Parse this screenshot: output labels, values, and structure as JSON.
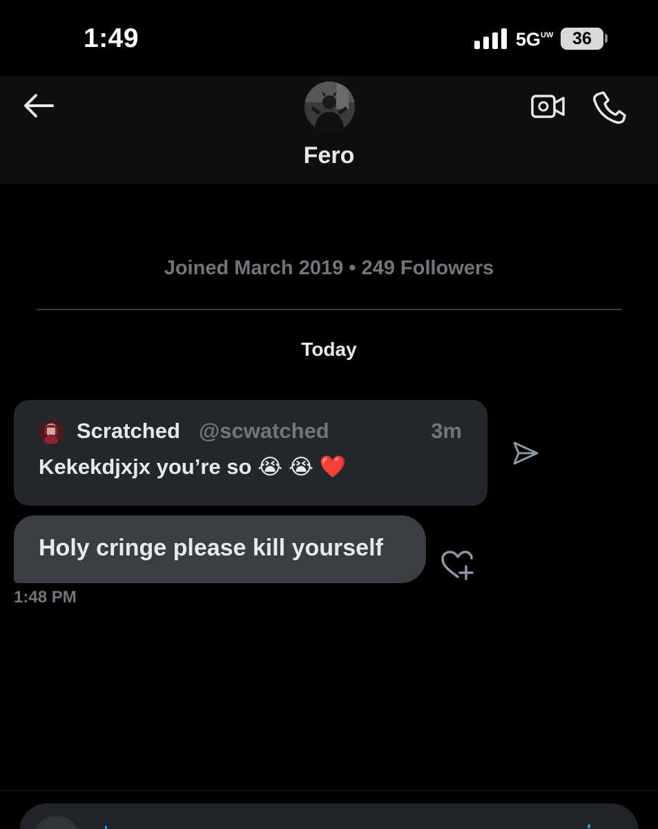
{
  "status_bar": {
    "time": "1:49",
    "network": "5G",
    "network_sup": "UW",
    "battery": "36"
  },
  "header": {
    "contact_name": "Fero",
    "avatar_icon": "profile-photo",
    "back_icon": "arrow-left-icon",
    "video_icon": "video-call-icon",
    "phone_icon": "phone-icon"
  },
  "profile": {
    "joined_text": "Joined March 2019 • 249 Followers"
  },
  "conversation": {
    "date_divider": "Today",
    "quoted_post": {
      "author_name": "Scratched",
      "author_handle": "@scwatched",
      "age": "3m",
      "text": "Kekekdjxjx you’re so 😭 😭 ❤️"
    },
    "message": {
      "text": "Holy cringe please kill yourself",
      "timestamp": "1:48 PM"
    }
  },
  "colors": {
    "background": "#000000",
    "header_bg": "#0f0f0f",
    "bubble_quote": "#24272b",
    "bubble_message": "#3a3d42",
    "muted_text": "#71767b",
    "accent": "#1d9bf0"
  }
}
